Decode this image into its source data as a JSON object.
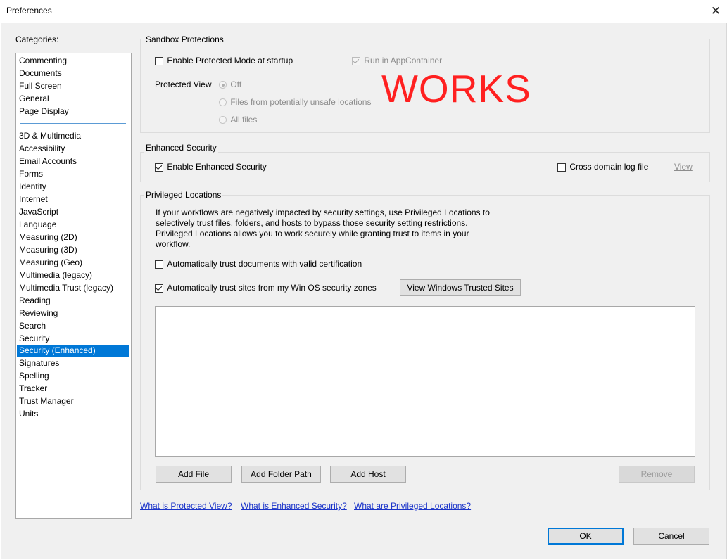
{
  "window": {
    "title": "Preferences",
    "close_glyph": "✕"
  },
  "categories": {
    "label": "Categories:",
    "items": [
      "Commenting",
      "Documents",
      "Full Screen",
      "General",
      "Page Display",
      "3D & Multimedia",
      "Accessibility",
      "Email Accounts",
      "Forms",
      "Identity",
      "Internet",
      "JavaScript",
      "Language",
      "Measuring (2D)",
      "Measuring (3D)",
      "Measuring (Geo)",
      "Multimedia (legacy)",
      "Multimedia Trust (legacy)",
      "Reading",
      "Reviewing",
      "Search",
      "Security",
      "Security (Enhanced)",
      "Signatures",
      "Spelling",
      "Tracker",
      "Trust Manager",
      "Units"
    ],
    "selected": "Security (Enhanced)"
  },
  "sandbox": {
    "title": "Sandbox Protections",
    "enable_protected_mode": {
      "label": "Enable Protected Mode at startup",
      "checked": false
    },
    "run_in_appcontainer": {
      "label": "Run in AppContainer",
      "checked": true,
      "enabled": false
    },
    "protected_view_label": "Protected View",
    "protected_view_options": [
      "Off",
      "Files from potentially unsafe locations",
      "All files"
    ],
    "protected_view_selected": "Off",
    "overlay_text": "WORKS"
  },
  "enhanced": {
    "title": "Enhanced Security",
    "enable_enhanced": {
      "label": "Enable Enhanced Security",
      "checked": true
    },
    "cross_domain_log": {
      "label": "Cross domain log file",
      "checked": false
    },
    "view_label": "View"
  },
  "privileged": {
    "title": "Privileged Locations",
    "description": [
      "If your workflows are negatively impacted by security settings, use Privileged Locations to",
      "selectively trust files, folders, and hosts to bypass those security setting restrictions.",
      "Privileged Locations allows you to work securely while granting trust to items in your",
      "workflow."
    ],
    "trust_certified_docs": {
      "label": "Automatically trust documents with valid certification",
      "checked": false
    },
    "trust_win_zones": {
      "label": "Automatically trust sites from my Win OS security zones",
      "checked": true
    },
    "view_trusted_sites_label": "View Windows Trusted Sites",
    "locations": [],
    "add_file_label": "Add File",
    "add_folder_label": "Add Folder Path",
    "add_host_label": "Add Host",
    "remove_label": "Remove"
  },
  "help_links": {
    "protected_view": "What is Protected View?",
    "enhanced_security": "What is Enhanced Security?",
    "privileged_locations": "What are Privileged Locations?"
  },
  "dialog_buttons": {
    "ok": "OK",
    "cancel": "Cancel"
  },
  "colors": {
    "selection": "#0078d7",
    "link": "#1a33c9",
    "overlay": "#ff2020"
  }
}
